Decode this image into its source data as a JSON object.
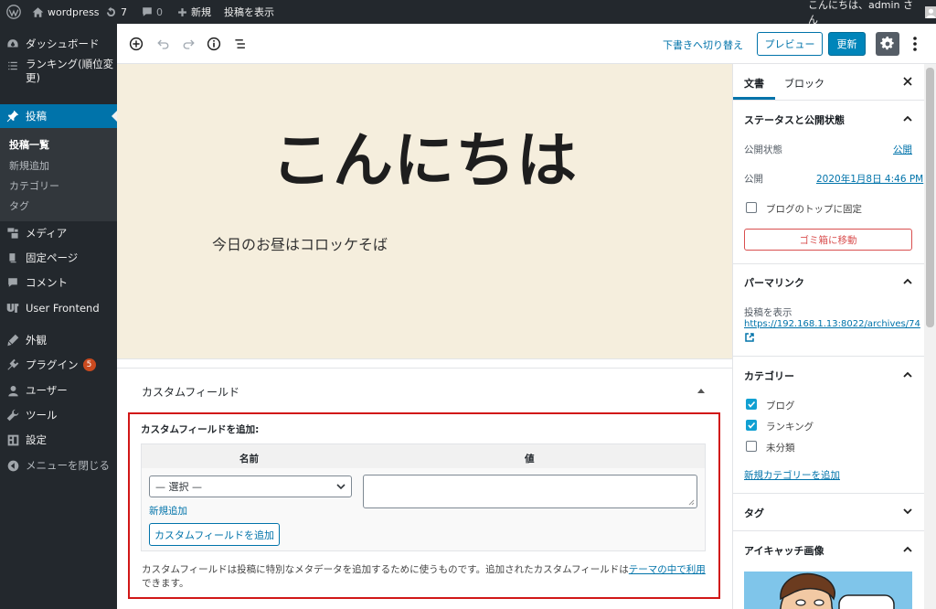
{
  "admin_bar": {
    "site_name": "wordpress",
    "updates_count": "7",
    "comments_count": "0",
    "new_label": "新規",
    "view_post_label": "投稿を表示",
    "greeting": "こんにちは、admin さん"
  },
  "sidebar": {
    "items": [
      {
        "label": "ダッシュボード",
        "icon": "dashboard-icon"
      },
      {
        "label": "ランキング(順位変更)",
        "icon": "list-icon"
      },
      {
        "label": "投稿",
        "icon": "pin-icon"
      },
      {
        "label": "メディア",
        "icon": "media-icon"
      },
      {
        "label": "固定ページ",
        "icon": "page-icon"
      },
      {
        "label": "コメント",
        "icon": "comment-icon"
      },
      {
        "label": "User Frontend",
        "icon": "frontend-icon"
      },
      {
        "label": "外観",
        "icon": "appearance-icon"
      },
      {
        "label": "プラグイン",
        "icon": "plugin-icon",
        "badge": "5"
      },
      {
        "label": "ユーザー",
        "icon": "user-icon"
      },
      {
        "label": "ツール",
        "icon": "tool-icon"
      },
      {
        "label": "設定",
        "icon": "settings-icon"
      },
      {
        "label": "メニューを閉じる",
        "icon": "collapse-icon"
      }
    ],
    "submenu": [
      "投稿一覧",
      "新規追加",
      "カテゴリー",
      "タグ"
    ]
  },
  "header": {
    "switch_draft": "下書きへ切り替え",
    "preview": "プレビュー",
    "update": "更新"
  },
  "editor": {
    "title": "こんにちは",
    "paragraph": "今日のお昼はコロッケそば"
  },
  "custom_fields": {
    "section_title": "カスタムフィールド",
    "add_label": "カスタムフィールドを追加:",
    "col_name": "名前",
    "col_value": "値",
    "select_value": "— 選択 —",
    "new_link": "新規追加",
    "add_button": "カスタムフィールドを追加",
    "description_1": "カスタムフィールドは投稿に特別なメタデータを追加するために使うものです。追加されたカスタムフィールドは",
    "description_link": "テーマの中で利用",
    "description_2": "できます。"
  },
  "settings": {
    "tab_document": "文書",
    "tab_block": "ブロック",
    "status_panel": {
      "title": "ステータスと公開状態",
      "visibility_label": "公開状態",
      "visibility_value": "公開",
      "publish_label": "公開",
      "publish_value": "2020年1月8日 4:46 PM",
      "sticky_label": "ブログのトップに固定",
      "trash_button": "ゴミ箱に移動"
    },
    "permalink_panel": {
      "title": "パーマリンク",
      "view_label": "投稿を表示",
      "url": "https://192.168.1.13:8022/archives/74"
    },
    "category_panel": {
      "title": "カテゴリー",
      "items": [
        {
          "label": "ブログ",
          "checked": true
        },
        {
          "label": "ランキング",
          "checked": true
        },
        {
          "label": "未分類",
          "checked": false
        }
      ],
      "add_new": "新規カテゴリーを追加"
    },
    "tags_panel": {
      "title": "タグ"
    },
    "featured_panel": {
      "title": "アイキャッチ画像"
    }
  },
  "colors": {
    "admin_dark": "#23282d",
    "accent_blue": "#0073aa",
    "highlight_red": "#d11717",
    "cover_bg": "#f5eedd"
  }
}
